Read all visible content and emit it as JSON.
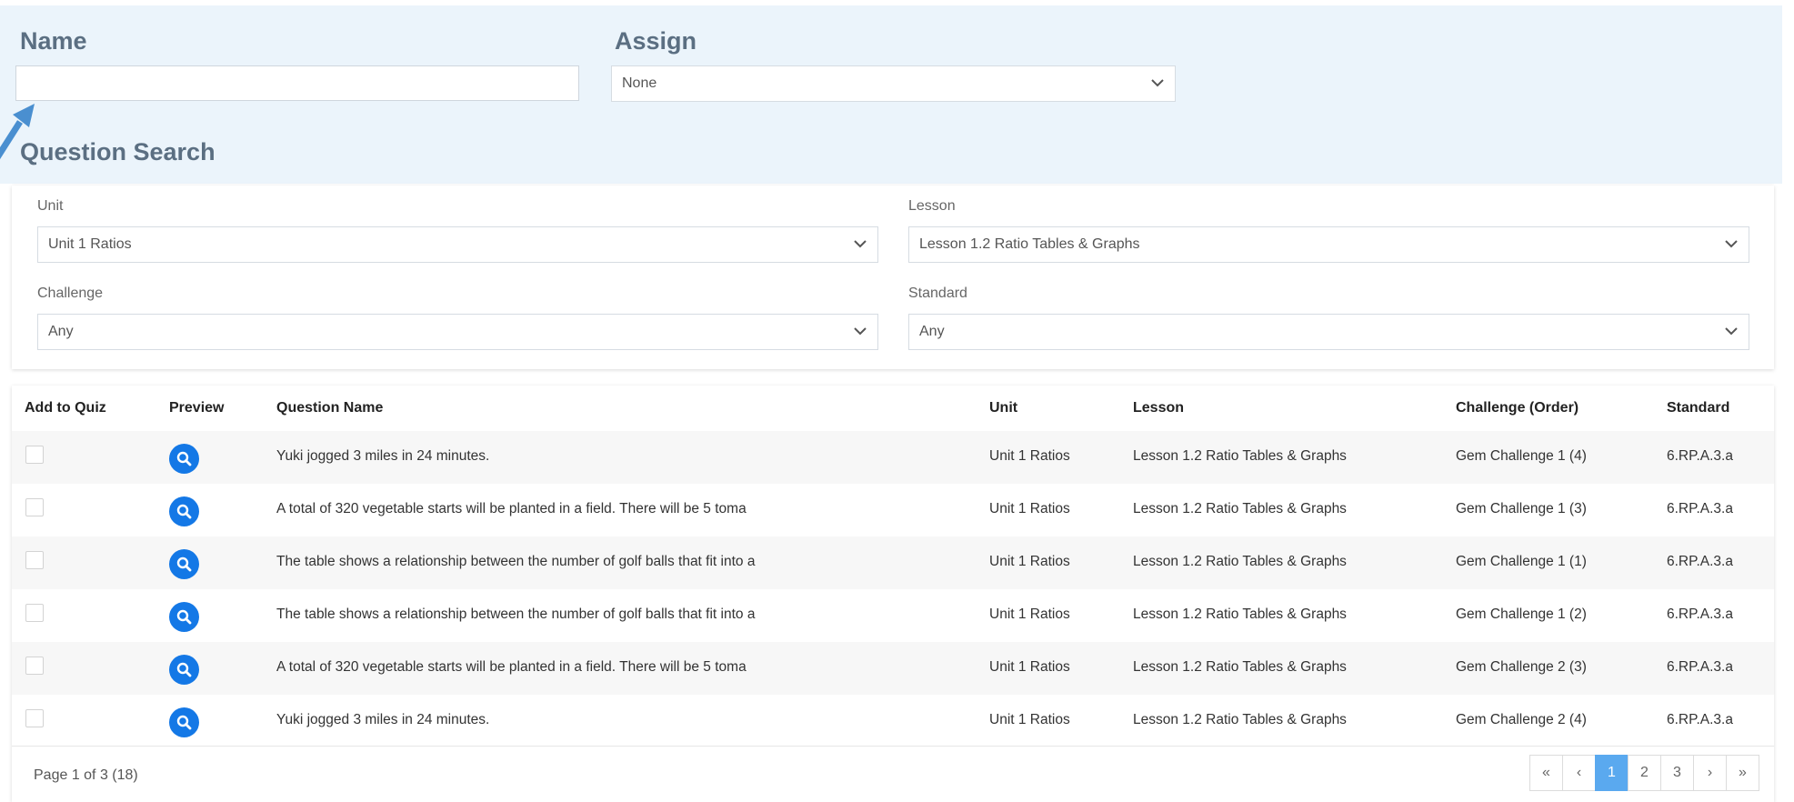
{
  "labels": {
    "name": "Name",
    "assign": "Assign",
    "question_search": "Question Search"
  },
  "name_input": {
    "value": "",
    "placeholder": ""
  },
  "assign_select": {
    "selected": "None"
  },
  "filters": {
    "unit": {
      "label": "Unit",
      "selected": "Unit 1 Ratios"
    },
    "lesson": {
      "label": "Lesson",
      "selected": "Lesson 1.2 Ratio Tables & Graphs"
    },
    "challenge": {
      "label": "Challenge",
      "selected": "Any"
    },
    "standard": {
      "label": "Standard",
      "selected": "Any"
    }
  },
  "table": {
    "headers": [
      "Add to Quiz",
      "Preview",
      "Question Name",
      "Unit",
      "Lesson",
      "Challenge (Order)",
      "Standard"
    ],
    "rows": [
      {
        "question": "Yuki jogged 3 miles in 24 minutes.",
        "unit": "Unit 1 Ratios",
        "lesson": "Lesson 1.2 Ratio Tables & Graphs",
        "challenge": "Gem Challenge 1 (4)",
        "standard": "6.RP.A.3.a"
      },
      {
        "question": "A total of 320 vegetable starts will be planted in a field. There will be 5 toma",
        "unit": "Unit 1 Ratios",
        "lesson": "Lesson 1.2 Ratio Tables & Graphs",
        "challenge": "Gem Challenge 1 (3)",
        "standard": "6.RP.A.3.a"
      },
      {
        "question": "The table shows a relationship between the number of golf balls that fit into a",
        "unit": "Unit 1 Ratios",
        "lesson": "Lesson 1.2 Ratio Tables & Graphs",
        "challenge": "Gem Challenge 1 (1)",
        "standard": "6.RP.A.3.a"
      },
      {
        "question": "The table shows a relationship between the number of golf balls that fit into a",
        "unit": "Unit 1 Ratios",
        "lesson": "Lesson 1.2 Ratio Tables & Graphs",
        "challenge": "Gem Challenge 1 (2)",
        "standard": "6.RP.A.3.a"
      },
      {
        "question": "A total of 320 vegetable starts will be planted in a field. There will be 5 toma",
        "unit": "Unit 1 Ratios",
        "lesson": "Lesson 1.2 Ratio Tables & Graphs",
        "challenge": "Gem Challenge 2 (3)",
        "standard": "6.RP.A.3.a"
      },
      {
        "question": "Yuki jogged 3 miles in 24 minutes.",
        "unit": "Unit 1 Ratios",
        "lesson": "Lesson 1.2 Ratio Tables & Graphs",
        "challenge": "Gem Challenge 2 (4)",
        "standard": "6.RP.A.3.a"
      }
    ]
  },
  "pagination": {
    "info": "Page 1 of 3 (18)",
    "first": "«",
    "prev": "‹",
    "pages": [
      "1",
      "2",
      "3"
    ],
    "next": "›",
    "last": "»"
  },
  "icons": {
    "dropdown": "chevron-down-icon",
    "preview": "search-icon",
    "annotation": "arrow-icon"
  },
  "colors": {
    "panel_background": "#ebf4fb",
    "preview_button": "#1478e6",
    "active_page": "#5aa9ef",
    "annotation_arrow": "#4a8fd0"
  }
}
